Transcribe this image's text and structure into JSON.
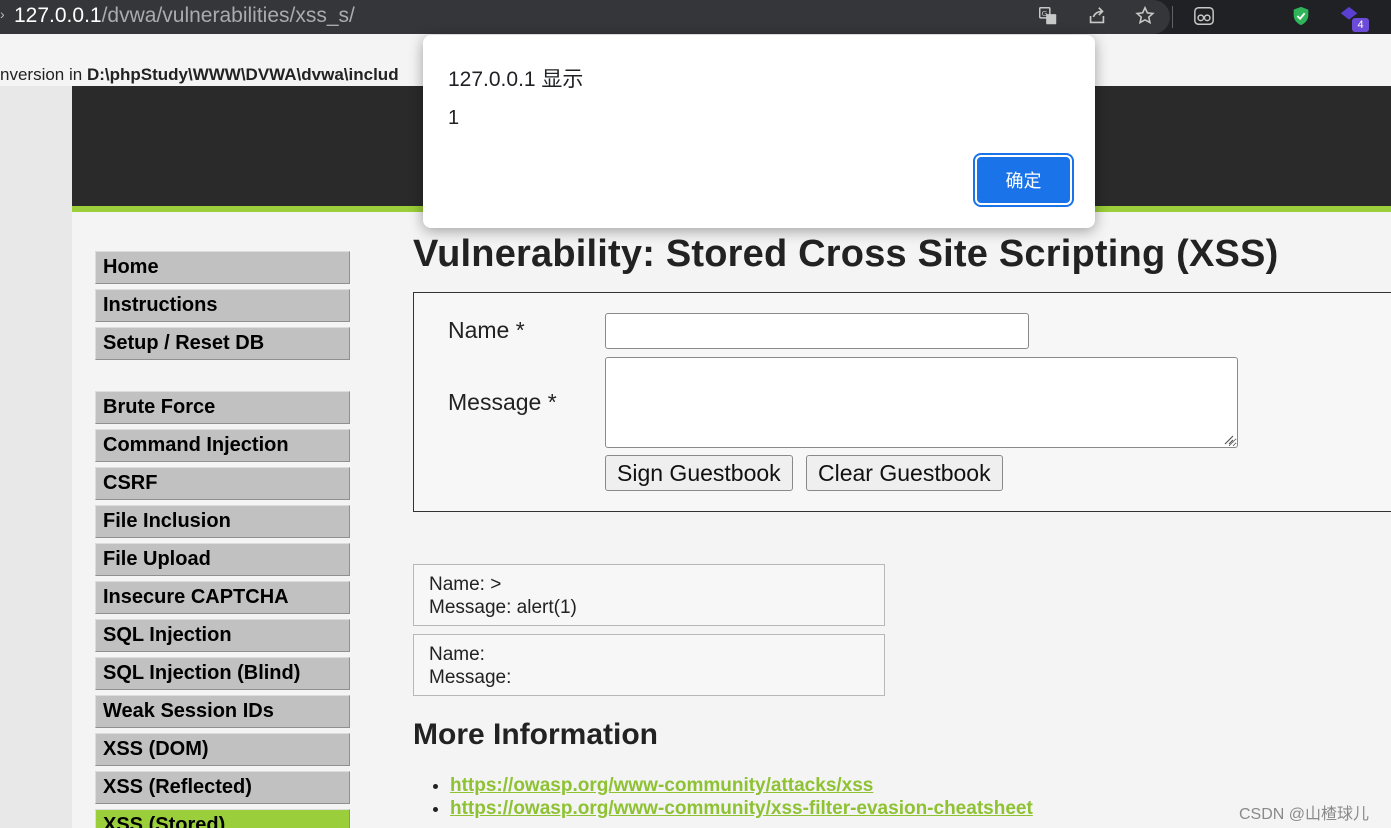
{
  "browser": {
    "url_host": "127.0.0.1",
    "url_path": "/dvwa/vulnerabilities/xss_s/",
    "extension_badge": "4",
    "icons": [
      "translate-icon",
      "share-icon",
      "bookmark-star-icon",
      "reading-mode-icon",
      "shield-check-icon",
      "extension-icon"
    ]
  },
  "notice": {
    "prefix": "nversion in ",
    "path": "D:\\phpStudy\\WWW\\DVWA\\dvwa\\includ"
  },
  "sidebar": {
    "group1": [
      {
        "label": "Home"
      },
      {
        "label": "Instructions"
      },
      {
        "label": "Setup / Reset DB"
      }
    ],
    "group2": [
      {
        "label": "Brute Force"
      },
      {
        "label": "Command Injection"
      },
      {
        "label": "CSRF"
      },
      {
        "label": "File Inclusion"
      },
      {
        "label": "File Upload"
      },
      {
        "label": "Insecure CAPTCHA"
      },
      {
        "label": "SQL Injection"
      },
      {
        "label": "SQL Injection (Blind)"
      },
      {
        "label": "Weak Session IDs"
      },
      {
        "label": "XSS (DOM)"
      },
      {
        "label": "XSS (Reflected)"
      },
      {
        "label": "XSS (Stored)"
      }
    ],
    "active": "XSS (Stored)"
  },
  "main": {
    "title": "Vulnerability: Stored Cross Site Scripting (XSS)",
    "form": {
      "name_label": "Name *",
      "name_value": "",
      "message_label": "Message *",
      "message_value": "",
      "sign_button": "Sign Guestbook",
      "clear_button": "Clear Guestbook"
    },
    "entries": [
      {
        "name_line": "Name: >",
        "message_line": "Message: alert(1)"
      },
      {
        "name_line": "Name:",
        "message_line": "Message:"
      }
    ],
    "more_info_title": "More Information",
    "links": [
      "https://owasp.org/www-community/attacks/xss",
      "https://owasp.org/www-community/xss-filter-evasion-cheatsheet"
    ]
  },
  "dialog": {
    "title": "127.0.0.1 显示",
    "message": "1",
    "ok_label": "确定"
  },
  "watermark": "CSDN @山楂球儿",
  "colors": {
    "accent_green": "#9ace3a",
    "link_green": "#8ec232",
    "header_dark": "#2a2a2a",
    "dialog_button": "#1a73e8"
  }
}
